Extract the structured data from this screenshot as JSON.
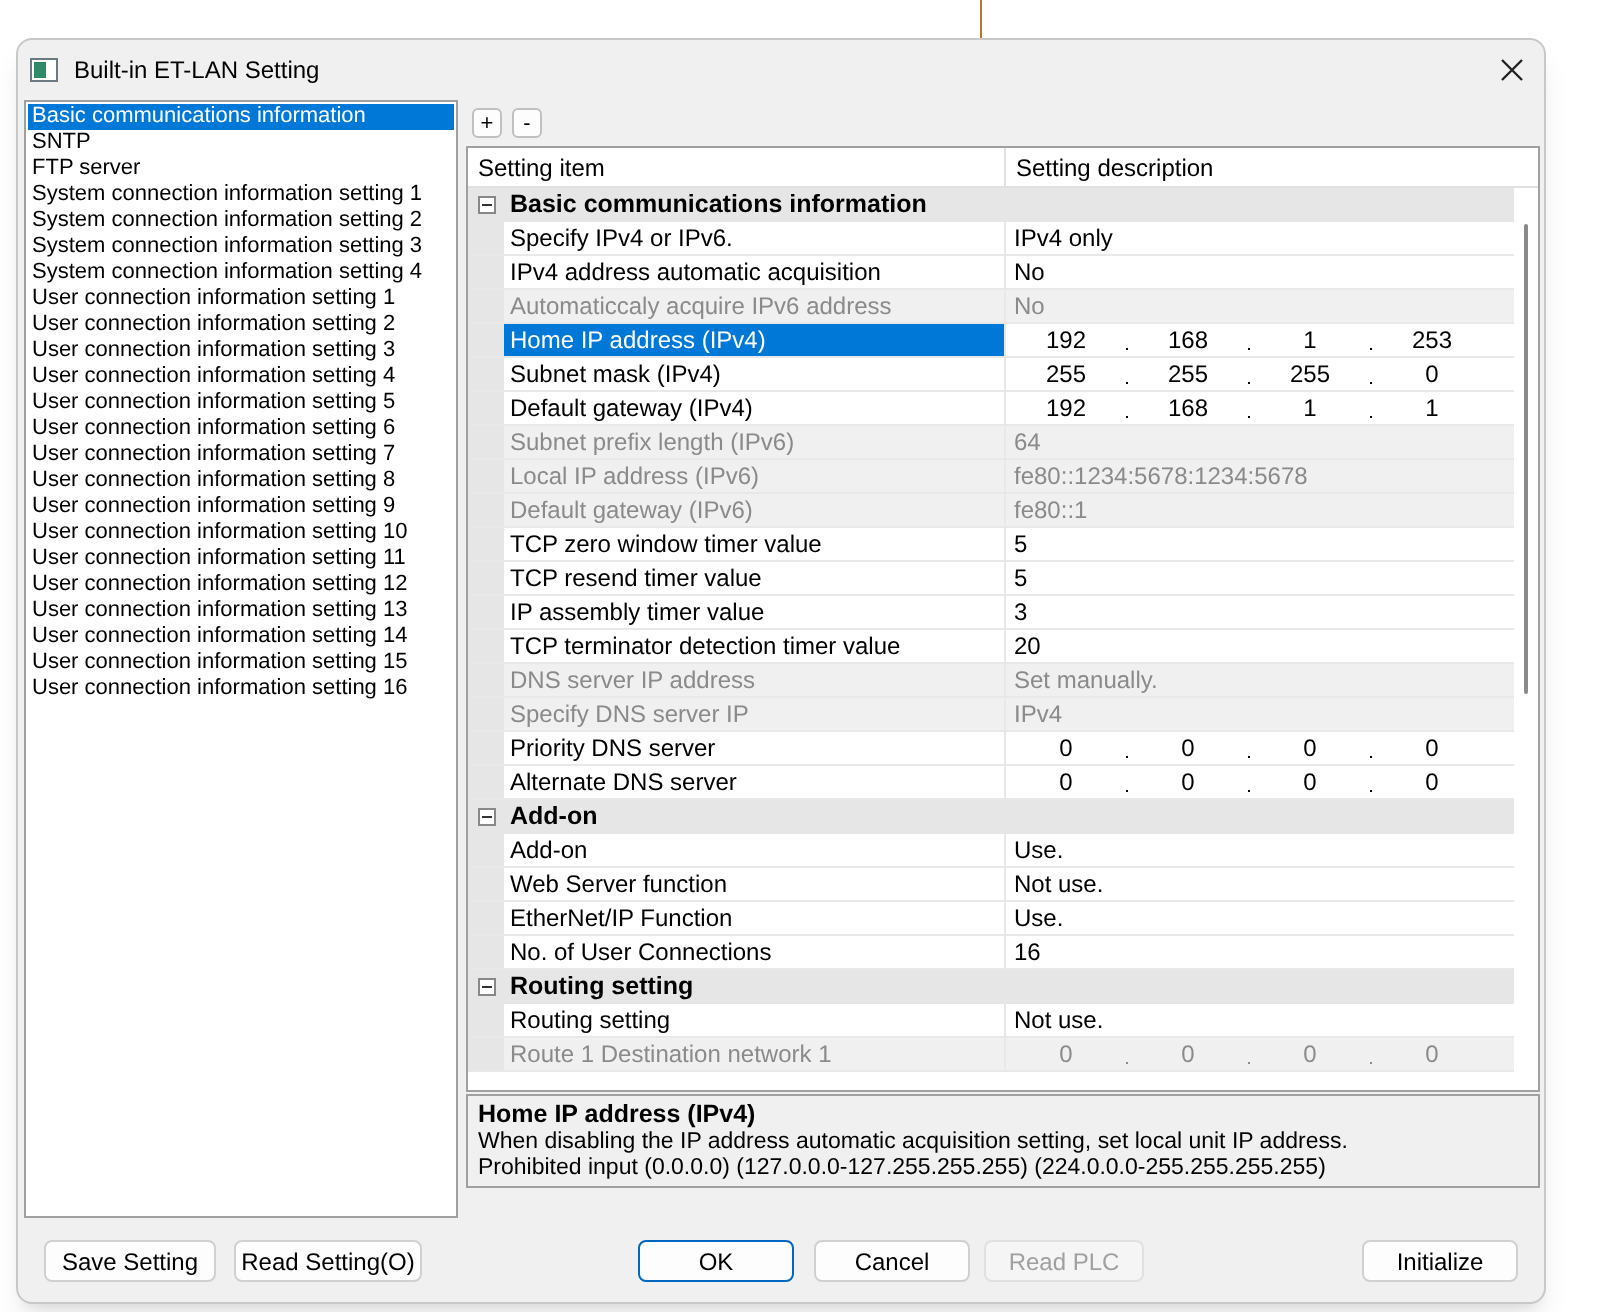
{
  "window": {
    "title": "Built-in ET-LAN Setting"
  },
  "sidebar": {
    "items": [
      {
        "label": "Basic communications information",
        "selected": true
      },
      {
        "label": "SNTP",
        "selected": false
      },
      {
        "label": "FTP server",
        "selected": false
      },
      {
        "label": "System connection information setting 1",
        "selected": false
      },
      {
        "label": "System connection information setting 2",
        "selected": false
      },
      {
        "label": "System connection information setting 3",
        "selected": false
      },
      {
        "label": "System connection information setting 4",
        "selected": false
      },
      {
        "label": "User connection information setting 1",
        "selected": false
      },
      {
        "label": "User connection information setting 2",
        "selected": false
      },
      {
        "label": "User connection information setting 3",
        "selected": false
      },
      {
        "label": "User connection information setting 4",
        "selected": false
      },
      {
        "label": "User connection information setting 5",
        "selected": false
      },
      {
        "label": "User connection information setting 6",
        "selected": false
      },
      {
        "label": "User connection information setting 7",
        "selected": false
      },
      {
        "label": "User connection information setting 8",
        "selected": false
      },
      {
        "label": "User connection information setting 9",
        "selected": false
      },
      {
        "label": "User connection information setting 10",
        "selected": false
      },
      {
        "label": "User connection information setting 11",
        "selected": false
      },
      {
        "label": "User connection information setting 12",
        "selected": false
      },
      {
        "label": "User connection information setting 13",
        "selected": false
      },
      {
        "label": "User connection information setting 14",
        "selected": false
      },
      {
        "label": "User connection information setting 15",
        "selected": false
      },
      {
        "label": "User connection information setting 16",
        "selected": false
      }
    ]
  },
  "toolbar": {
    "expand": "+",
    "collapse": "-"
  },
  "table": {
    "columns": [
      "Setting item",
      "Setting description"
    ],
    "groups": [
      {
        "title": "Basic communications information",
        "expanded": true,
        "rows": [
          {
            "kind": "text",
            "name": "Specify IPv4 or IPv6.",
            "value": "IPv4 only",
            "disabled": false,
            "selected": false
          },
          {
            "kind": "text",
            "name": "IPv4 address automatic acquisition",
            "value": "No",
            "disabled": false,
            "selected": false
          },
          {
            "kind": "text",
            "name": "Automaticcaly acquire IPv6 address",
            "value": "No",
            "disabled": true,
            "selected": false
          },
          {
            "kind": "ip",
            "name": "Home IP address (IPv4)",
            "octets": [
              "192",
              "168",
              "1",
              "253"
            ],
            "disabled": false,
            "selected": true
          },
          {
            "kind": "ip",
            "name": "Subnet mask (IPv4)",
            "octets": [
              "255",
              "255",
              "255",
              "0"
            ],
            "disabled": false,
            "selected": false
          },
          {
            "kind": "ip",
            "name": "Default gateway (IPv4)",
            "octets": [
              "192",
              "168",
              "1",
              "1"
            ],
            "disabled": false,
            "selected": false
          },
          {
            "kind": "text",
            "name": "Subnet prefix length (IPv6)",
            "value": "64",
            "disabled": true,
            "selected": false
          },
          {
            "kind": "text",
            "name": "Local IP address (IPv6)",
            "value": "fe80::1234:5678:1234:5678",
            "disabled": true,
            "selected": false
          },
          {
            "kind": "text",
            "name": "Default gateway (IPv6)",
            "value": "fe80::1",
            "disabled": true,
            "selected": false
          },
          {
            "kind": "text",
            "name": "TCP zero window timer value",
            "value": "5",
            "disabled": false,
            "selected": false
          },
          {
            "kind": "text",
            "name": "TCP resend timer value",
            "value": "5",
            "disabled": false,
            "selected": false
          },
          {
            "kind": "text",
            "name": "IP assembly timer value",
            "value": "3",
            "disabled": false,
            "selected": false
          },
          {
            "kind": "text",
            "name": "TCP terminator detection timer value",
            "value": "20",
            "disabled": false,
            "selected": false
          },
          {
            "kind": "text",
            "name": "DNS server IP address",
            "value": "Set manually.",
            "disabled": true,
            "selected": false
          },
          {
            "kind": "text",
            "name": "Specify DNS server IP",
            "value": "IPv4",
            "disabled": true,
            "selected": false
          },
          {
            "kind": "ip",
            "name": "Priority DNS server",
            "octets": [
              "0",
              "0",
              "0",
              "0"
            ],
            "disabled": false,
            "selected": false
          },
          {
            "kind": "ip",
            "name": "Alternate DNS server",
            "octets": [
              "0",
              "0",
              "0",
              "0"
            ],
            "disabled": false,
            "selected": false
          }
        ]
      },
      {
        "title": "Add-on",
        "expanded": true,
        "rows": [
          {
            "kind": "text",
            "name": "Add-on",
            "value": "Use.",
            "disabled": false,
            "selected": false
          },
          {
            "kind": "text",
            "name": "Web Server function",
            "value": "Not use.",
            "disabled": false,
            "selected": false
          },
          {
            "kind": "text",
            "name": "EtherNet/IP Function",
            "value": "Use.",
            "disabled": false,
            "selected": false
          },
          {
            "kind": "text",
            "name": "No. of User Connections",
            "value": "16",
            "disabled": false,
            "selected": false
          }
        ]
      },
      {
        "title": "Routing setting",
        "expanded": true,
        "rows": [
          {
            "kind": "text",
            "name": "Routing setting",
            "value": "Not use.",
            "disabled": false,
            "selected": false
          },
          {
            "kind": "ip",
            "name": "Route 1 Destination network 1",
            "octets": [
              "0",
              "0",
              "0",
              "0"
            ],
            "disabled": true,
            "selected": false
          }
        ]
      }
    ]
  },
  "description": {
    "title": "Home IP address (IPv4)",
    "lines": [
      "When disabling the IP address automatic acquisition setting, set local unit IP address.",
      "Prohibited input (0.0.0.0) (127.0.0.0-127.255.255.255) (224.0.0.0-255.255.255.255)"
    ]
  },
  "buttons": [
    {
      "label": "Save Setting",
      "kind": "normal",
      "disabled": false
    },
    {
      "label": "Read Setting(O)",
      "kind": "normal",
      "disabled": false
    },
    {
      "label": "OK",
      "kind": "default",
      "disabled": false
    },
    {
      "label": "Cancel",
      "kind": "normal",
      "disabled": false
    },
    {
      "label": "Read PLC",
      "kind": "normal",
      "disabled": true
    },
    {
      "label": "Initialize",
      "kind": "normal",
      "disabled": false
    }
  ]
}
